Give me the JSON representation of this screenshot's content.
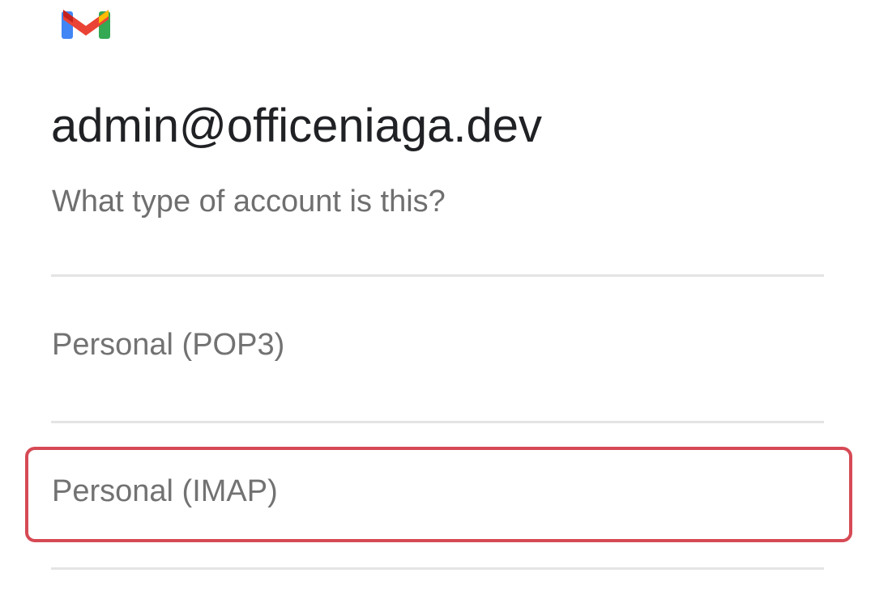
{
  "brand": {
    "logo_icon": "gmail-logo-icon",
    "colors": {
      "blue": "#4285F4",
      "red": "#EA4335",
      "yellow": "#FBBC04",
      "green": "#34A853",
      "dark_red": "#C5221F"
    }
  },
  "account": {
    "email": "admin@officeniaga.dev"
  },
  "prompt": {
    "question": "What type of account is this?"
  },
  "options": [
    {
      "label": "Personal (POP3)",
      "highlighted": false
    },
    {
      "label": "Personal (IMAP)",
      "highlighted": true
    }
  ],
  "highlight_color": "#d64a55"
}
